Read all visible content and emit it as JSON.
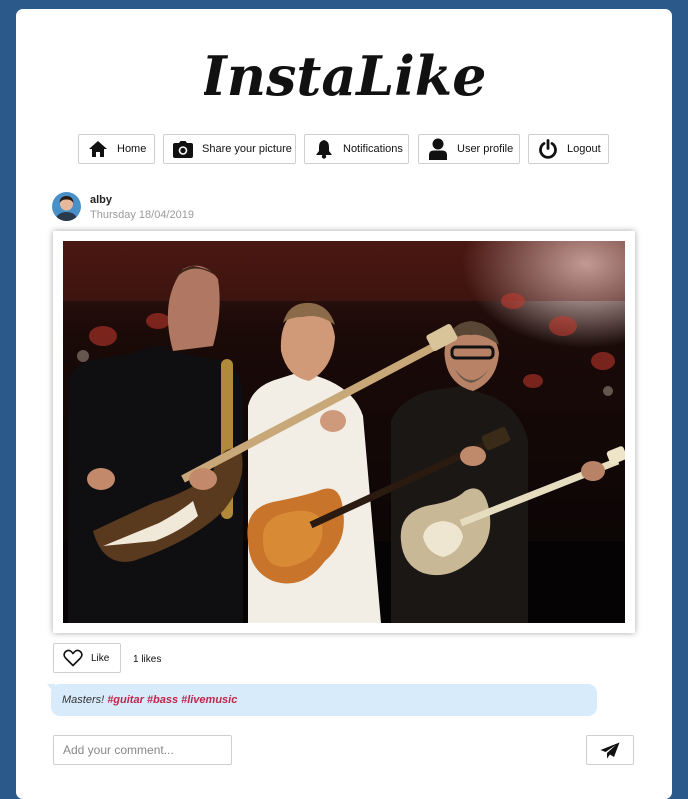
{
  "app": {
    "logo_text": "InstaLike"
  },
  "nav": {
    "items": [
      {
        "label": "Home",
        "icon": "home-icon"
      },
      {
        "label": "Share your picture",
        "icon": "camera-icon"
      },
      {
        "label": "Notifications",
        "icon": "bell-icon"
      },
      {
        "label": "User profile",
        "icon": "user-icon"
      },
      {
        "label": "Logout",
        "icon": "power-icon"
      }
    ]
  },
  "post": {
    "username": "alby",
    "date": "Thursday 18/04/2019",
    "like_label": "Like",
    "likes_text": "1 likes",
    "caption_text": "Masters!",
    "tags": [
      "#guitar",
      "#bass",
      "#livemusic"
    ]
  },
  "comment": {
    "placeholder": "Add your comment..."
  },
  "colors": {
    "background": "#2b5a8a",
    "caption_bubble": "#d8ebfb",
    "tag": "#c0264a"
  }
}
